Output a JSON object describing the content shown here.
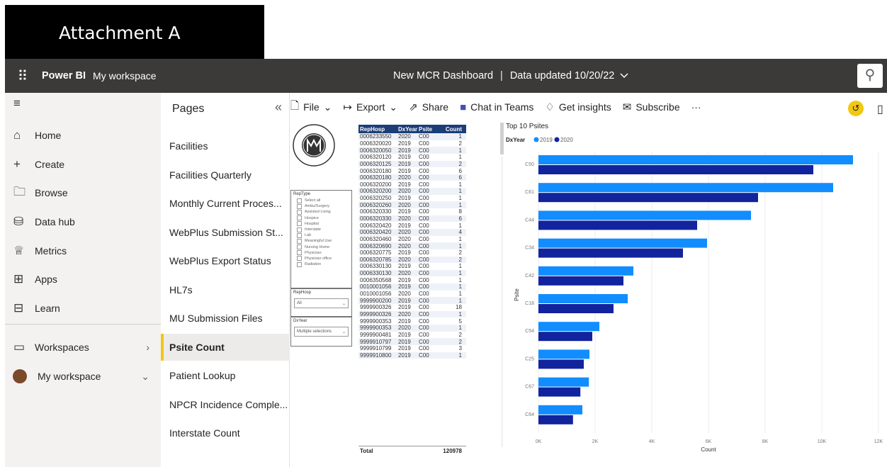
{
  "attachment_label": "Attachment A",
  "topbar": {
    "brand": "Power BI",
    "workspace": "My workspace",
    "report_title": "New MCR Dashboard",
    "separator": "|",
    "data_updated": "Data updated 10/20/22"
  },
  "leftnav": {
    "items": [
      {
        "label": "Home",
        "icon": "home-icon"
      },
      {
        "label": "Create",
        "icon": "plus-icon"
      },
      {
        "label": "Browse",
        "icon": "folder-icon"
      },
      {
        "label": "Data hub",
        "icon": "database-icon"
      },
      {
        "label": "Metrics",
        "icon": "trophy-icon"
      },
      {
        "label": "Apps",
        "icon": "apps-icon"
      },
      {
        "label": "Learn",
        "icon": "book-icon"
      }
    ],
    "workspaces": "Workspaces",
    "my_workspace": "My workspace"
  },
  "pages": {
    "title": "Pages",
    "items": [
      "Facilities",
      "Facilities Quarterly",
      "Monthly Current Proces...",
      "WebPlus Submission St...",
      "WebPlus Export Status",
      "HL7s",
      "MU Submission Files",
      "Psite Count",
      "Patient Lookup",
      "NPCR Incidence Comple...",
      "Interstate Count"
    ],
    "selected_index": 7
  },
  "toolbar": {
    "file": "File",
    "export": "Export",
    "share": "Share",
    "chat": "Chat in Teams",
    "insights": "Get insights",
    "subscribe": "Subscribe",
    "more": "···"
  },
  "slicers": {
    "reptype": {
      "title": "RepType",
      "options": [
        "Select all",
        "Ambu/Surgery",
        "Assisted Living",
        "Hospice",
        "Hospital",
        "Interstate",
        "Lab",
        "Meaningful Use",
        "Nursing Home",
        "Physician",
        "Physician office",
        "Radiation"
      ]
    },
    "rephosp": {
      "title": "RepHosp",
      "value": "All"
    },
    "dxyear": {
      "title": "DxYear",
      "value": "Multiple selections"
    }
  },
  "table": {
    "headers": [
      "RepHosp",
      "DxYear",
      "Psite",
      "Count"
    ],
    "rows": [
      [
        "0006233550",
        "2020",
        "C00",
        "1"
      ],
      [
        "0006320020",
        "2019",
        "C00",
        "2"
      ],
      [
        "0006320050",
        "2019",
        "C00",
        "1"
      ],
      [
        "0006320120",
        "2019",
        "C00",
        "1"
      ],
      [
        "0006320125",
        "2019",
        "C00",
        "2"
      ],
      [
        "0006320180",
        "2019",
        "C00",
        "6"
      ],
      [
        "0006320180",
        "2020",
        "C00",
        "6"
      ],
      [
        "0006320200",
        "2019",
        "C00",
        "1"
      ],
      [
        "0006320200",
        "2020",
        "C00",
        "1"
      ],
      [
        "0006320250",
        "2019",
        "C00",
        "1"
      ],
      [
        "0006320260",
        "2020",
        "C00",
        "1"
      ],
      [
        "0006320330",
        "2019",
        "C00",
        "8"
      ],
      [
        "0006320330",
        "2020",
        "C00",
        "6"
      ],
      [
        "0006320420",
        "2019",
        "C00",
        "1"
      ],
      [
        "0006320420",
        "2020",
        "C00",
        "4"
      ],
      [
        "0006320460",
        "2020",
        "C00",
        "1"
      ],
      [
        "0006320690",
        "2020",
        "C00",
        "1"
      ],
      [
        "0006320775",
        "2019",
        "C00",
        "2"
      ],
      [
        "0006320785",
        "2020",
        "C00",
        "2"
      ],
      [
        "0006330130",
        "2019",
        "C00",
        "1"
      ],
      [
        "0006330130",
        "2020",
        "C00",
        "1"
      ],
      [
        "0006350568",
        "2019",
        "C00",
        "1"
      ],
      [
        "0010001056",
        "2019",
        "C00",
        "1"
      ],
      [
        "0010001056",
        "2020",
        "C00",
        "1"
      ],
      [
        "9999900200",
        "2019",
        "C00",
        "1"
      ],
      [
        "9999900326",
        "2019",
        "C00",
        "18"
      ],
      [
        "9999900326",
        "2020",
        "C00",
        "1"
      ],
      [
        "9999900353",
        "2019",
        "C00",
        "5"
      ],
      [
        "9999900353",
        "2020",
        "C00",
        "1"
      ],
      [
        "9999900481",
        "2019",
        "C00",
        "2"
      ],
      [
        "9999910797",
        "2019",
        "C00",
        "2"
      ],
      [
        "9999910799",
        "2019",
        "C00",
        "3"
      ],
      [
        "9999910800",
        "2019",
        "C00",
        "1"
      ]
    ],
    "total_label": "Total",
    "total_value": "120978"
  },
  "chart_data": {
    "type": "bar",
    "orientation": "horizontal",
    "title": "Top 10 Psites",
    "legend_title": "DxYear",
    "xlabel": "Count",
    "ylabel": "Psite",
    "xlim": [
      0,
      12000
    ],
    "xticks": [
      "0K",
      "2K",
      "4K",
      "6K",
      "8K",
      "10K",
      "12K"
    ],
    "categories": [
      "C50",
      "C61",
      "C44",
      "C34",
      "C42",
      "C18",
      "C54",
      "C25",
      "C67",
      "C64"
    ],
    "series": [
      {
        "name": "2019",
        "color": "#118dff",
        "values": [
          11100,
          10400,
          7500,
          5950,
          3350,
          3150,
          2150,
          1800,
          1780,
          1550
        ]
      },
      {
        "name": "2020",
        "color": "#12239e",
        "values": [
          9700,
          7750,
          5600,
          5100,
          3000,
          2650,
          1900,
          1600,
          1480,
          1220
        ]
      }
    ]
  }
}
